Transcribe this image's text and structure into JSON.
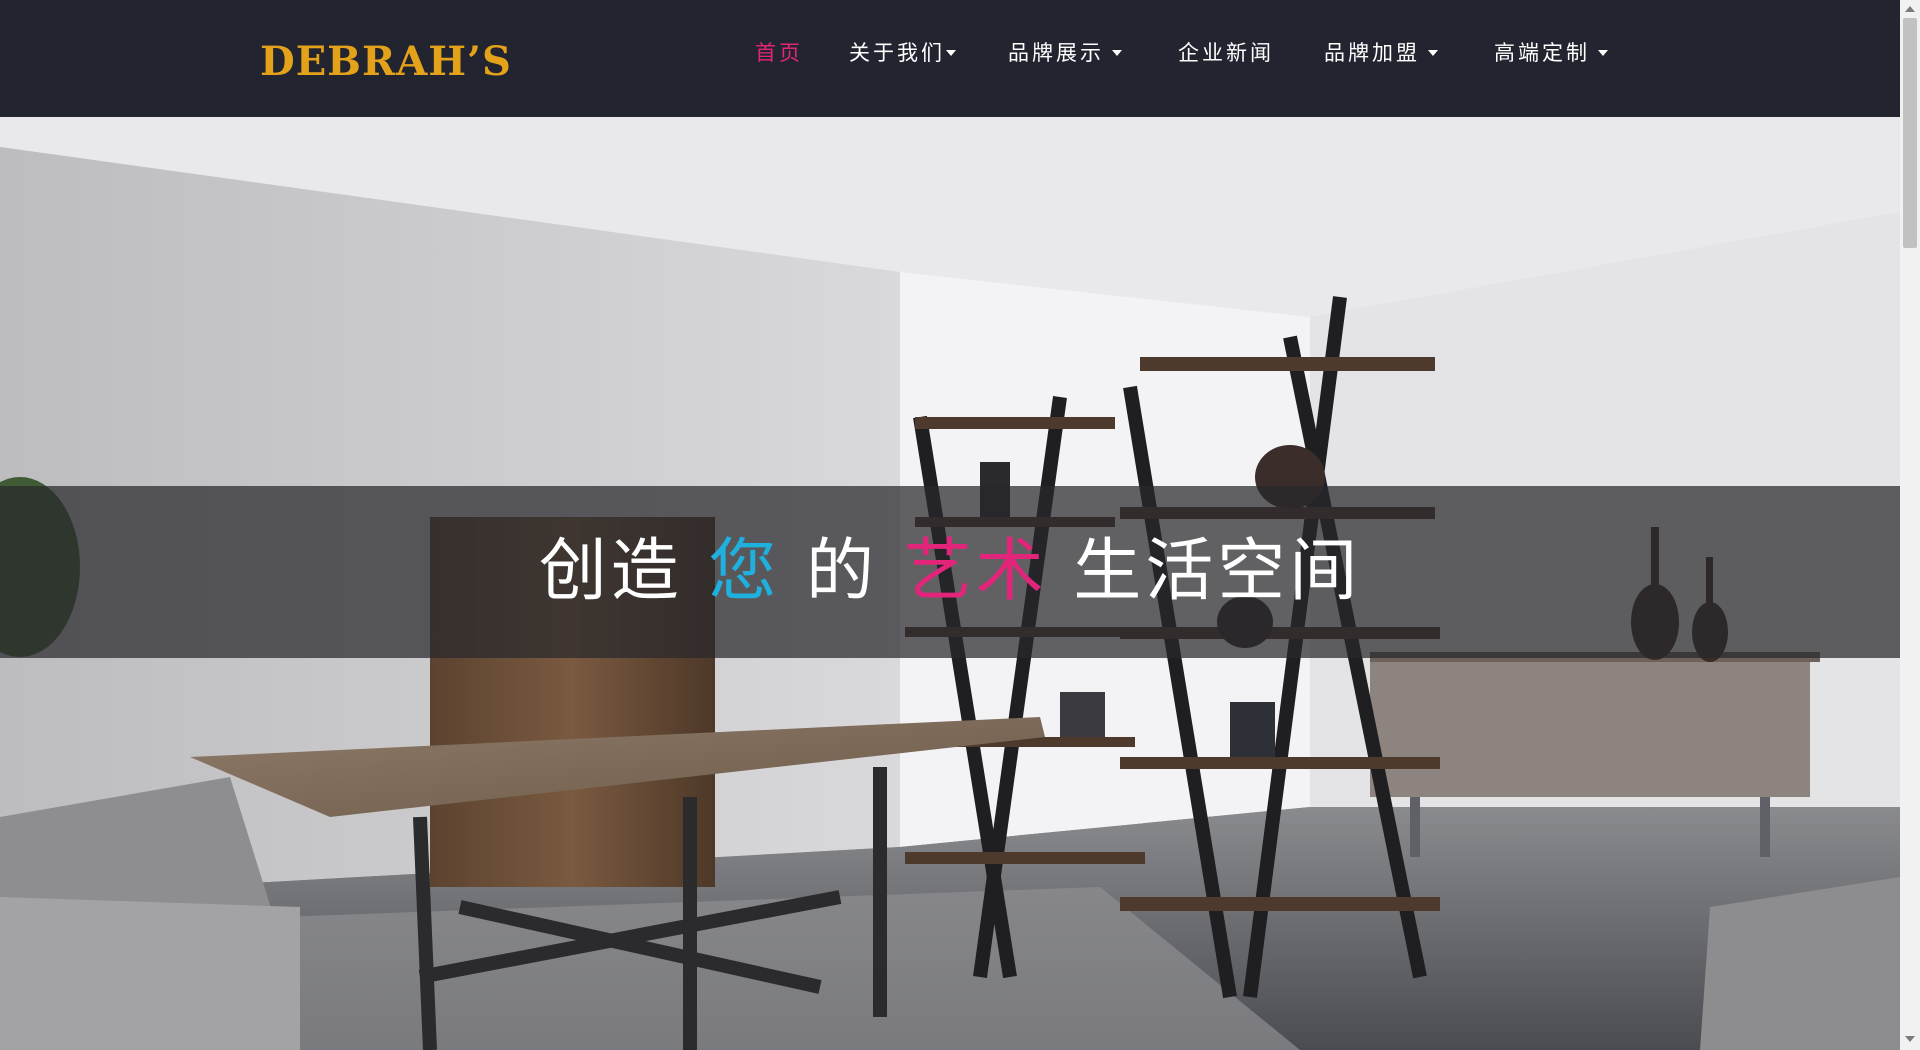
{
  "header": {
    "logo": "DEBRAH’S",
    "nav": [
      {
        "label": "首页",
        "active": true,
        "dropdown": false
      },
      {
        "label": "关于我们",
        "active": false,
        "dropdown": true
      },
      {
        "label": "品牌展示",
        "active": false,
        "dropdown": true
      },
      {
        "label": "企业新闻",
        "active": false,
        "dropdown": false
      },
      {
        "label": "品牌加盟",
        "active": false,
        "dropdown": true
      },
      {
        "label": "高端定制",
        "active": false,
        "dropdown": true
      }
    ]
  },
  "hero": {
    "headline": {
      "part1": "创造",
      "part2": "您",
      "part3": "的",
      "part4": "艺术",
      "part5": "生活空间"
    }
  },
  "colors": {
    "header_bg": "#222530",
    "logo": "#e3a21a",
    "active_nav": "#e2257a",
    "accent_blue": "#1fb0e0",
    "accent_pink": "#e2257a"
  }
}
